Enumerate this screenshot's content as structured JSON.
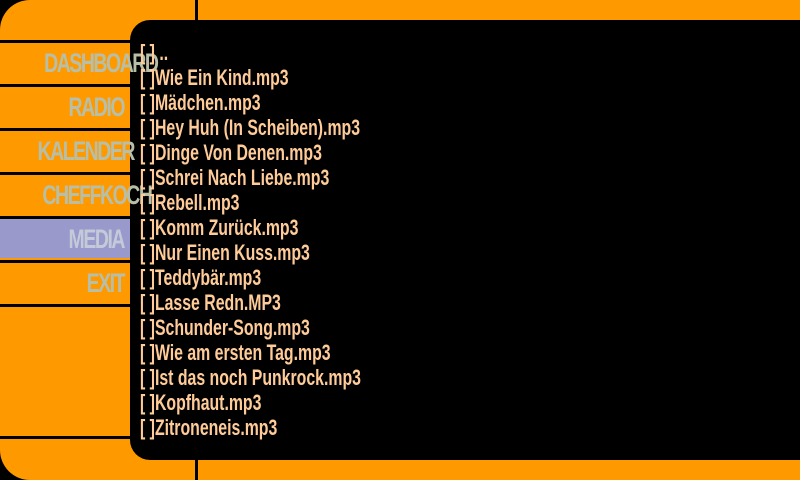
{
  "menu": {
    "items": [
      {
        "label": "DASHBOARD",
        "active": false
      },
      {
        "label": "RADIO",
        "active": false
      },
      {
        "label": "KALENDER",
        "active": false
      },
      {
        "label": "CHEFFKOCH",
        "active": false
      },
      {
        "label": "MEDIA",
        "active": true
      },
      {
        "label": "EXIT",
        "active": false
      }
    ]
  },
  "files": [
    "[ ] ..",
    "[ ]Wie Ein Kind.mp3",
    "[ ]Mädchen.mp3",
    "[ ]Hey Huh (In Scheiben).mp3",
    "[ ]Dinge Von Denen.mp3",
    "[ ]Schrei Nach Liebe.mp3",
    "[ ]Rebell.mp3",
    "[ ]Komm Zurück.mp3",
    "[ ]Nur Einen Kuss.mp3",
    "[ ]Teddybär.mp3",
    "[ ]Lasse Redn.MP3",
    "[ ]Schunder-Song.mp3",
    "[ ]Wie am ersten Tag.mp3",
    "[ ]Ist das noch Punkrock.mp3",
    "[ ]Kopfhaut.mp3",
    "[ ]Zitroneneis.mp3"
  ],
  "colors": {
    "frame": "#ff9900",
    "active": "#9999cc",
    "text": "#ffcc99",
    "menu_text": "#b8bfa8"
  }
}
